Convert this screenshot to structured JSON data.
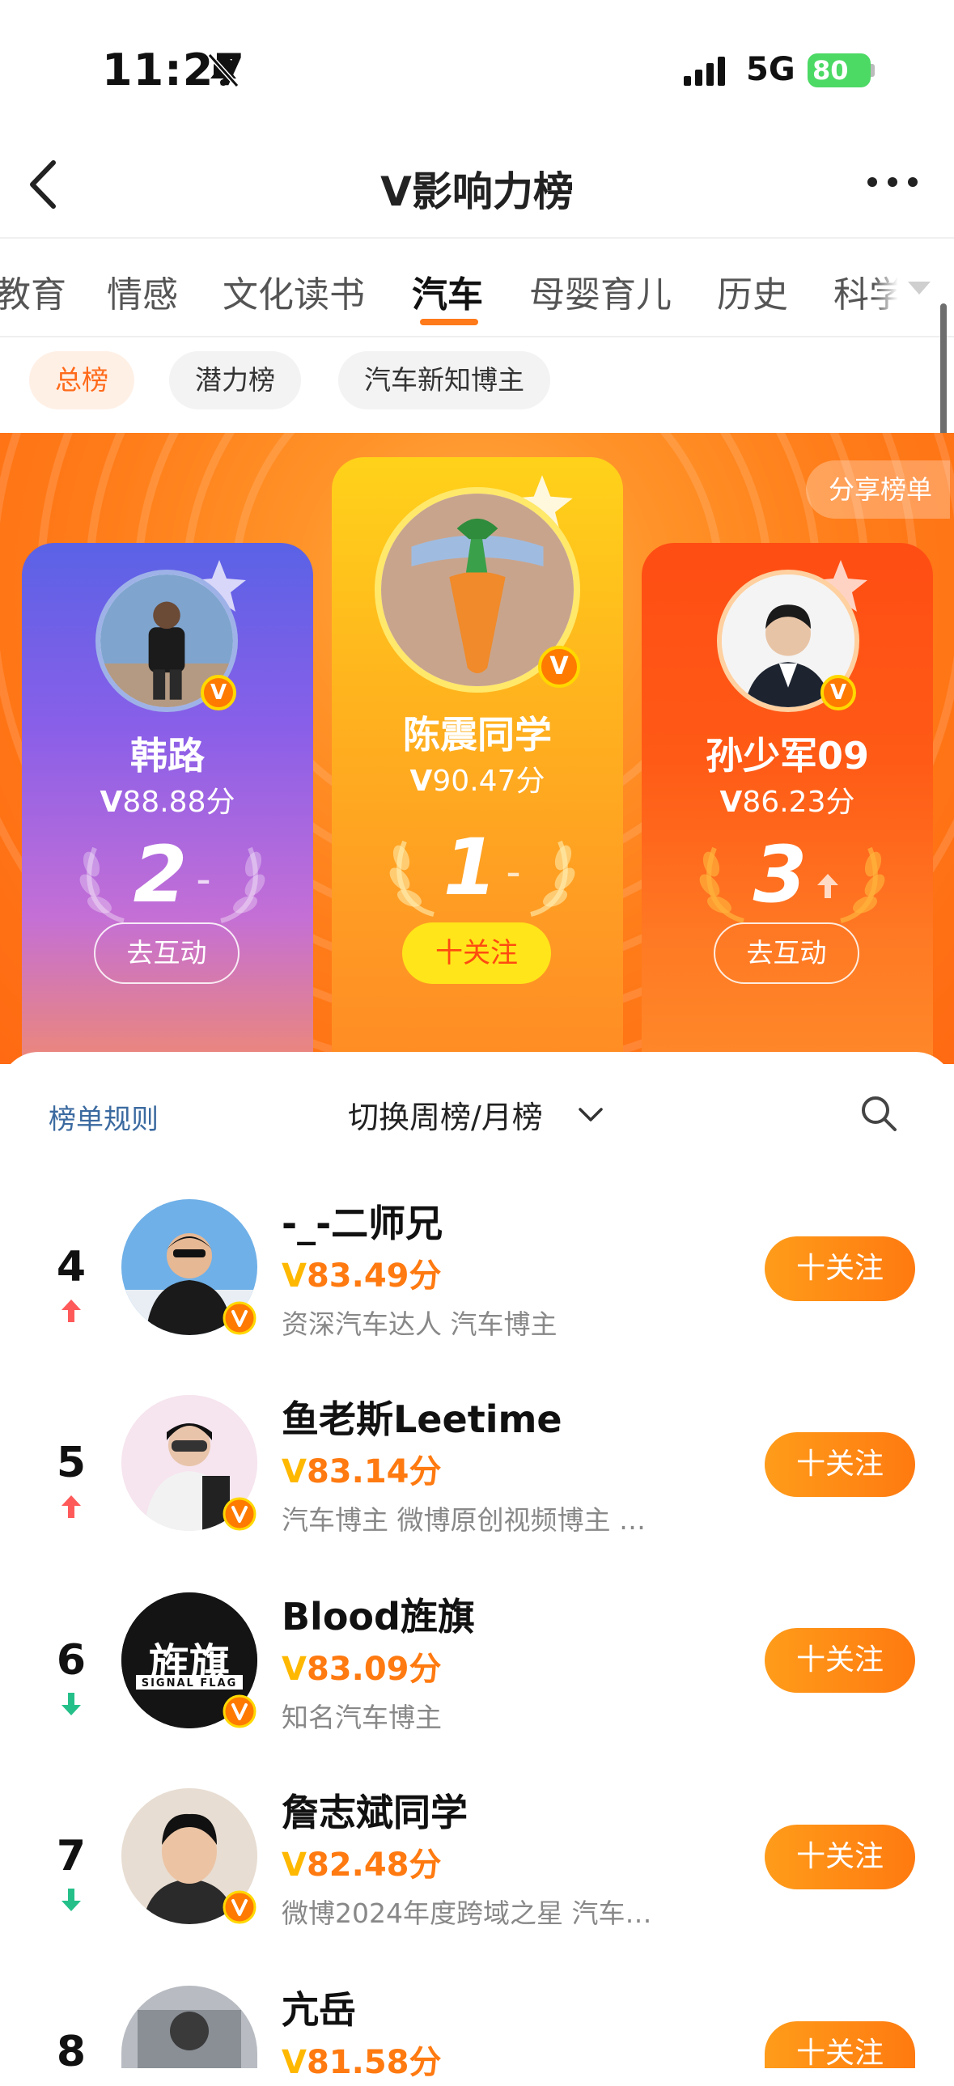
{
  "status": {
    "time": "11:27",
    "network": "5G",
    "battery": "80"
  },
  "nav": {
    "title": "V影响力榜"
  },
  "tabs": [
    "教育",
    "情感",
    "文化读书",
    "汽车",
    "母婴育儿",
    "历史",
    "科学"
  ],
  "active_tab": "汽车",
  "subtabs": [
    "总榜",
    "潜力榜",
    "汽车新知博主"
  ],
  "share_label": "分享榜单",
  "podium": [
    {
      "name": "陈震同学",
      "score": "90.47分",
      "rank": "1",
      "trend": "–",
      "action": "十关注"
    },
    {
      "name": "韩路",
      "score": "88.88分",
      "rank": "2",
      "trend": "–",
      "action": "去互动"
    },
    {
      "name": "孙少军09",
      "score": "86.23分",
      "rank": "3",
      "trend": "up",
      "action": "去互动"
    }
  ],
  "list_header": {
    "rules": "榜单规则",
    "switch": "切换周榜/月榜"
  },
  "list": [
    {
      "rank": "4",
      "trend": "up",
      "name": "-_-二师兄",
      "score": "83.49分",
      "desc": "资深汽车达人 汽车博主",
      "follow": "十关注"
    },
    {
      "rank": "5",
      "trend": "up",
      "name": "鱼老斯Leetime",
      "score": "83.14分",
      "desc": "汽车博主 微博原创视频博主 …",
      "follow": "十关注"
    },
    {
      "rank": "6",
      "trend": "down",
      "name": "Blood旌旗",
      "score": "83.09分",
      "desc": "知名汽车博主",
      "follow": "十关注",
      "avatar_text": "旌旗",
      "avatar_sub": "SIGNAL FLAG"
    },
    {
      "rank": "7",
      "trend": "down",
      "name": "詹志斌同学",
      "score": "82.48分",
      "desc": "微博2024年度跨域之星 汽车…",
      "follow": "十关注"
    },
    {
      "rank": "8",
      "trend": "",
      "name": "亢岳",
      "score": "81.58分",
      "desc": "",
      "follow": "十关注"
    }
  ],
  "colors": {
    "accent": "#ff7a10",
    "hero_orange": "#ff8a24",
    "rules_blue": "#3b6aa0"
  }
}
